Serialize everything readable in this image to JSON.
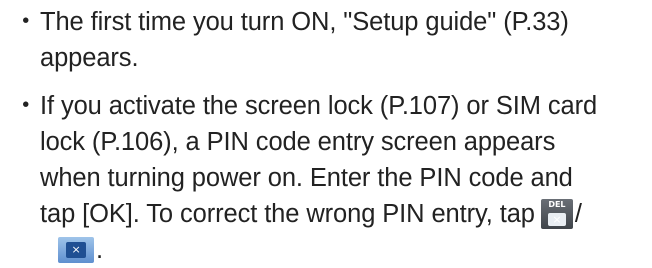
{
  "bullet_char": "・",
  "notes": [
    {
      "lines": [
        "The first time you turn ON, \"Setup guide\" (P.33)",
        "appears."
      ]
    },
    {
      "lines": [
        "If you activate the screen lock (P.107) or SIM card",
        "lock (P.106), a PIN code entry screen appears",
        "when turning power on. Enter the PIN code and",
        "tap [OK]. To correct the wrong PIN entry, tap"
      ],
      "slash": "/",
      "period": "."
    }
  ],
  "icons": {
    "del_key": "delete-key-icon",
    "del_key_text": "DEL",
    "del_key_glyph": "×",
    "clear_key": "clear-key-icon",
    "clear_key_glyph": "×"
  },
  "colors": {
    "text": "#222222",
    "del_key_bg": "#4f545a",
    "clear_key_bg": "#7aa7df",
    "clear_key_fg": "#1f4f93"
  }
}
